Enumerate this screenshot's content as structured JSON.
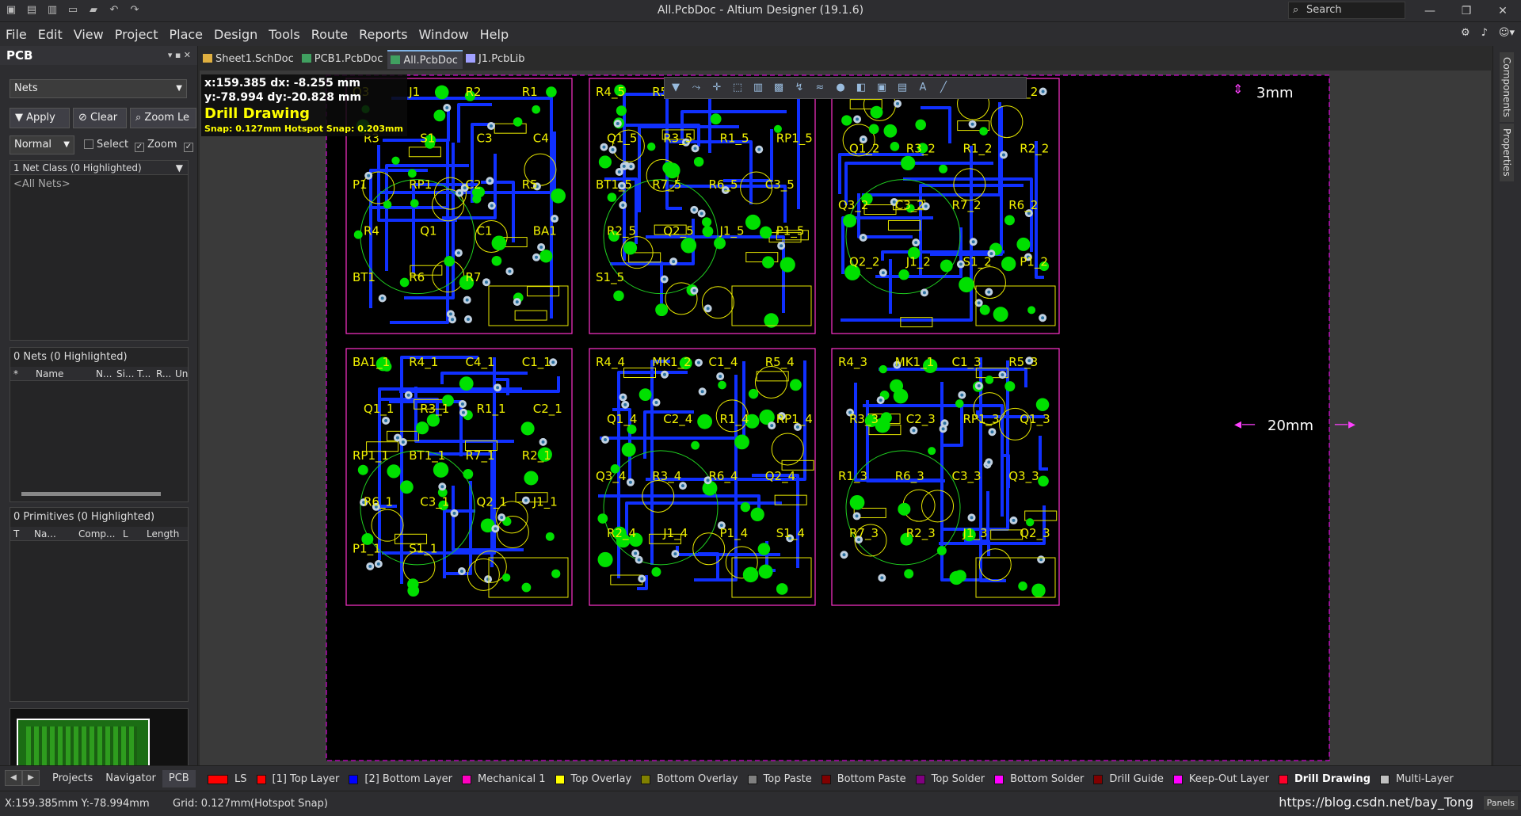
{
  "titlebar": {
    "title": "All.PcbDoc - Altium Designer (19.1.6)",
    "search_label": "Search",
    "minimize": "—",
    "maximize": "❐",
    "close": "✕"
  },
  "menu": [
    "File",
    "Edit",
    "View",
    "Project",
    "Place",
    "Design",
    "Tools",
    "Route",
    "Reports",
    "Window",
    "Help"
  ],
  "pcb_panel": {
    "title": "PCB",
    "mode": "Nets",
    "apply": "Apply",
    "clear": "Clear",
    "zoom": "Zoom Le",
    "mask_mode": "Normal",
    "select": "Select",
    "zoom_chk": "Zoom",
    "net_class": "1 Net Class (0 Highlighted)",
    "all_nets": "<All Nets>",
    "nets_count": "0 Nets (0 Highlighted)",
    "nets_cols": [
      "*",
      "Name",
      "N...",
      "Si...",
      "T...",
      "R...",
      "Un"
    ],
    "primitives": "0 Primitives (0 Highlighted)",
    "prim_cols": [
      "T",
      "Na...",
      "Comp...",
      "L",
      "Length"
    ]
  },
  "doc_tabs": [
    "Sheet1.SchDoc",
    "PCB1.PcbDoc",
    "All.PcbDoc",
    "J1.PcbLib"
  ],
  "active_tab": "All.PcbDoc",
  "hud": {
    "line1": "x:159.385   dx: -8.255  mm",
    "line2": "y:-78.994    dy:-20.828 mm",
    "title": "Drill Drawing",
    "snap": "Snap: 0.127mm Hotspot Snap: 0.203mm"
  },
  "annotations": {
    "gap_top": "3mm",
    "gap_side": "20mm"
  },
  "panel_tabs": [
    "Projects",
    "Navigator",
    "PCB"
  ],
  "active_panel_tab": "PCB",
  "layers": [
    {
      "name": "LS",
      "color": "#ff0000"
    },
    {
      "name": "[1] Top Layer",
      "color": "#ff0000"
    },
    {
      "name": "[2] Bottom Layer",
      "color": "#0000ff"
    },
    {
      "name": "Mechanical 1",
      "color": "#ff00c0"
    },
    {
      "name": "Top Overlay",
      "color": "#ffff00"
    },
    {
      "name": "Bottom Overlay",
      "color": "#808000"
    },
    {
      "name": "Top Paste",
      "color": "#808080"
    },
    {
      "name": "Bottom Paste",
      "color": "#800000"
    },
    {
      "name": "Top Solder",
      "color": "#800080"
    },
    {
      "name": "Bottom Solder",
      "color": "#ff00ff"
    },
    {
      "name": "Drill Guide",
      "color": "#800000"
    },
    {
      "name": "Keep-Out Layer",
      "color": "#ff00ff"
    },
    {
      "name": "Drill Drawing",
      "color": "#ff002a"
    },
    {
      "name": "Multi-Layer",
      "color": "#c0c0c0"
    }
  ],
  "active_layer": "Drill Drawing",
  "right_tabs": [
    "Components",
    "Properties"
  ],
  "status": {
    "coords": "X:159.385mm Y:-78.994mm",
    "grid": "Grid: 0.127mm",
    "snap": "(Hotspot Snap)",
    "watermark": "https://blog.csdn.net/bay_Tong",
    "panels": "Panels"
  },
  "boards": [
    {
      "id": "b1",
      "labels": [
        "Q3",
        "J1",
        "R2",
        "R1",
        "R3",
        "S1",
        "C3",
        "C4",
        "P1",
        "RP1",
        "C2",
        "R5",
        "R4",
        "Q1",
        "C1",
        "BA1",
        "BT1",
        "R6",
        "R7"
      ]
    },
    {
      "id": "b2",
      "labels": [
        "R4_5",
        "R5_5",
        "C4_5",
        "Q3_5",
        "Q1_5",
        "R3_5",
        "R1_5",
        "RP1_5",
        "BT1_5",
        "R7_5",
        "R6_5",
        "C3_5",
        "R2_5",
        "Q2_5",
        "J1_5",
        "P1_5",
        "S1_5"
      ]
    },
    {
      "id": "b3",
      "labels": [
        "C4_2",
        "MK1",
        "C1_2",
        "C2_2",
        "Q1_2",
        "R3_2",
        "R1_2",
        "R2_2",
        "Q3_2",
        "C3_2",
        "R7_2",
        "R6_2",
        "Q2_2",
        "J1_2",
        "S1_2",
        "P1_2"
      ]
    },
    {
      "id": "b4",
      "labels": [
        "BA1_1",
        "R4_1",
        "C4_1",
        "C1_1",
        "Q1_1",
        "R3_1",
        "R1_1",
        "C2_1",
        "RP1_1",
        "BT1_1",
        "R7_1",
        "R2_1",
        "R6_1",
        "C3_1",
        "Q2_1",
        "J1_1",
        "P1_1",
        "S1_1"
      ]
    },
    {
      "id": "b5",
      "labels": [
        "R4_4",
        "MK1_2",
        "C1_4",
        "R5_4",
        "Q1_4",
        "C2_4",
        "R1_4",
        "RP1_4",
        "Q3_4",
        "R3_4",
        "R6_4",
        "Q2_4",
        "R2_4",
        "J1_4",
        "P1_4",
        "S1_4"
      ]
    },
    {
      "id": "b6",
      "labels": [
        "R4_3",
        "MK1_1",
        "C1_3",
        "R5_3",
        "R3_3",
        "C2_3",
        "RP1_3",
        "Q1_3",
        "R1_3",
        "R6_3",
        "C3_3",
        "Q3_3",
        "R7_3",
        "R2_3",
        "J1_3",
        "Q2_3"
      ]
    }
  ]
}
